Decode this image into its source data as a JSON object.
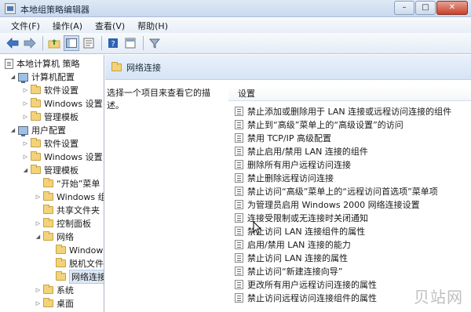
{
  "window": {
    "title": "本地组策略编辑器",
    "controls": {
      "minimize": "–",
      "maximize": "□",
      "close": "✕"
    }
  },
  "menubar": {
    "items": [
      "文件(F)",
      "操作(A)",
      "查看(V)",
      "帮助(H)"
    ]
  },
  "toolbar": {
    "icons": [
      "back-arrow-icon",
      "forward-arrow-icon",
      "up-folder-icon",
      "show-hide-tree-icon",
      "refresh-icon",
      "help-icon",
      "properties-icon",
      "filter-icon"
    ]
  },
  "tree": {
    "items": [
      {
        "label": "本地计算机 策略",
        "level": 0,
        "expander": "",
        "icon": "doc"
      },
      {
        "label": "计算机配置",
        "level": 1,
        "expander": "◢",
        "icon": "pc"
      },
      {
        "label": "软件设置",
        "level": 2,
        "expander": "▷",
        "icon": "folder"
      },
      {
        "label": "Windows 设置",
        "level": 2,
        "expander": "▷",
        "icon": "folder"
      },
      {
        "label": "管理模板",
        "level": 2,
        "expander": "▷",
        "icon": "folder"
      },
      {
        "label": "用户配置",
        "level": 1,
        "expander": "◢",
        "icon": "pc"
      },
      {
        "label": "软件设置",
        "level": 2,
        "expander": "▷",
        "icon": "folder"
      },
      {
        "label": "Windows 设置",
        "level": 2,
        "expander": "▷",
        "icon": "folder"
      },
      {
        "label": "管理模板",
        "level": 2,
        "expander": "◢",
        "icon": "folder"
      },
      {
        "label": "“开始”菜单",
        "level": 3,
        "expander": "",
        "icon": "folder"
      },
      {
        "label": "Windows 组",
        "level": 3,
        "expander": "▷",
        "icon": "folder"
      },
      {
        "label": "共享文件夹",
        "level": 3,
        "expander": "",
        "icon": "folder"
      },
      {
        "label": "控制面板",
        "level": 3,
        "expander": "▷",
        "icon": "folder"
      },
      {
        "label": "网络",
        "level": 3,
        "expander": "◢",
        "icon": "folder"
      },
      {
        "label": "Windows",
        "level": 4,
        "expander": "",
        "icon": "folder"
      },
      {
        "label": "脱机文件",
        "level": 4,
        "expander": "",
        "icon": "folder"
      },
      {
        "label": "网络连接",
        "level": 4,
        "expander": "",
        "icon": "folder",
        "selected": true
      },
      {
        "label": "系统",
        "level": 3,
        "expander": "▷",
        "icon": "folder"
      },
      {
        "label": "桌面",
        "level": 3,
        "expander": "▷",
        "icon": "folder"
      }
    ]
  },
  "right": {
    "header_title": "网络连接",
    "description": "选择一个项目来查看它的描述。",
    "column_header": "设置",
    "settings": [
      "禁止添加或删除用于 LAN 连接或远程访问连接的组件",
      "禁止到“高级”菜单上的“高级设置”的访问",
      "禁用 TCP/IP 高级配置",
      "禁止启用/禁用 LAN 连接的组件",
      "删除所有用户远程访问连接",
      "禁止删除远程访问连接",
      "禁止访问“高级”菜单上的“远程访问首选项”菜单项",
      "为管理员启用 Windows 2000 网络连接设置",
      "连接受限制或无连接时关闭通知",
      "禁止访问 LAN 连接组件的属性",
      "启用/禁用 LAN 连接的能力",
      "禁止访问 LAN 连接的属性",
      "禁止访问“新建连接向导”",
      "更改所有用户远程访问连接的属性",
      "禁止访问远程访问连接组件的属性"
    ]
  },
  "watermark": "贝站网"
}
